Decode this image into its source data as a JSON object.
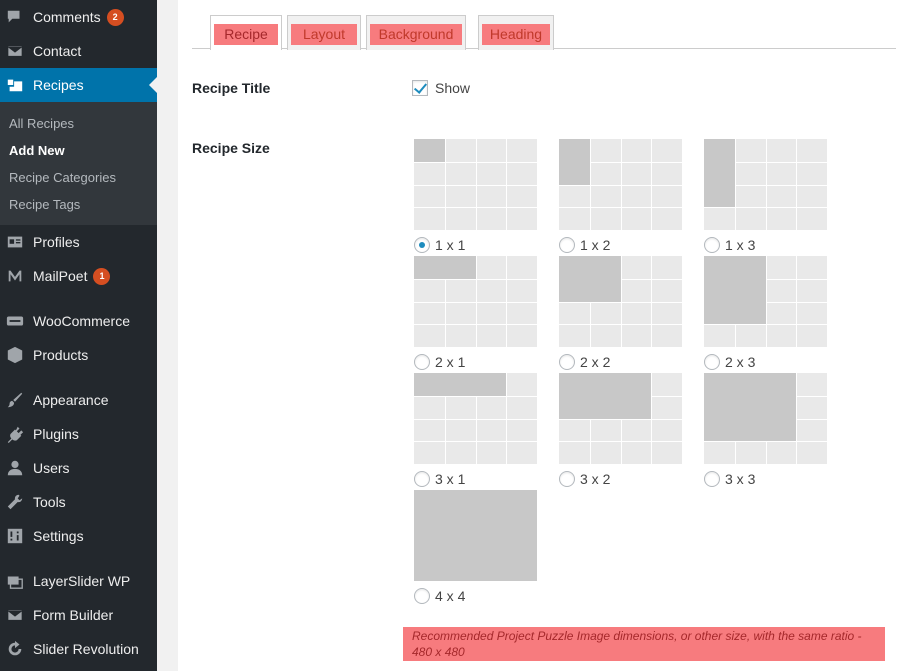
{
  "sidebar": {
    "items": [
      {
        "label": "Comments",
        "badge": "2",
        "icon": "comments-icon"
      },
      {
        "label": "Contact",
        "icon": "envelope-icon"
      },
      {
        "label": "Recipes",
        "icon": "recipes-icon"
      },
      {
        "label": "Profiles",
        "icon": "id-card-icon"
      },
      {
        "label": "MailPoet",
        "badge": "1",
        "icon": "mailpoet-icon"
      },
      {
        "label": "WooCommerce",
        "icon": "woocommerce-icon"
      },
      {
        "label": "Products",
        "icon": "box-icon"
      },
      {
        "label": "Appearance",
        "icon": "paintbrush-icon"
      },
      {
        "label": "Plugins",
        "icon": "plugin-icon"
      },
      {
        "label": "Users",
        "icon": "user-icon"
      },
      {
        "label": "Tools",
        "icon": "wrench-icon"
      },
      {
        "label": "Settings",
        "icon": "settings-icon"
      },
      {
        "label": "LayerSlider WP",
        "icon": "layers-icon"
      },
      {
        "label": "Form Builder",
        "icon": "envelope-icon"
      },
      {
        "label": "Slider Revolution",
        "icon": "refresh-icon"
      }
    ],
    "submenu": [
      "All Recipes",
      "Add New",
      "Recipe Categories",
      "Recipe Tags"
    ],
    "active_item": "Recipes",
    "current_submenu": "Add New"
  },
  "tabs": [
    "Recipe",
    "Layout",
    "Background",
    "Heading"
  ],
  "active_tab": "Recipe",
  "recipe_title": {
    "label": "Recipe Title",
    "checkbox_label": "Show",
    "checked": true
  },
  "recipe_size": {
    "label": "Recipe Size",
    "options": [
      "1 x 1",
      "1 x 2",
      "1 x 3",
      "2 x 1",
      "2 x 2",
      "2 x 3",
      "3 x 1",
      "3 x 2",
      "3 x 3",
      "4 x 4"
    ],
    "selected": "1 x 1"
  },
  "note": "Recommended Project Puzzle Image dimensions, or other size, with the same ratio - 480 x 480",
  "colors": {
    "accent": "#0073aa",
    "highlight": "#f77b7e",
    "sidebar": "#23282d",
    "badge": "#d54e21"
  }
}
